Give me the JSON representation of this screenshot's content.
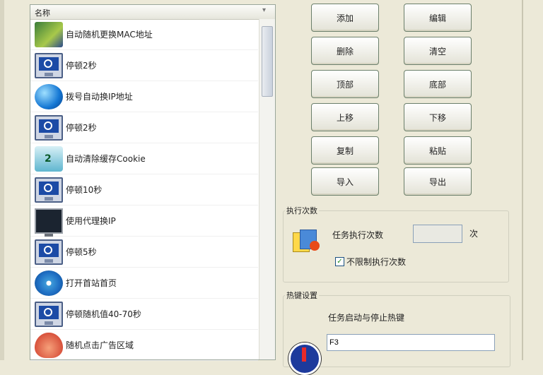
{
  "list": {
    "header": "名称",
    "items": [
      {
        "label": "自动随机更换MAC地址",
        "icon": "network-card-icon"
      },
      {
        "label": "停顿2秒",
        "icon": "monitor-clock-icon"
      },
      {
        "label": "拨号自动换IP地址",
        "icon": "globe-icon"
      },
      {
        "label": "停顿2秒",
        "icon": "monitor-clock-icon"
      },
      {
        "label": "自动清除缓存Cookie",
        "icon": "cookie-cleaner-icon"
      },
      {
        "label": "停顿10秒",
        "icon": "monitor-clock-icon"
      },
      {
        "label": "使用代理换IP",
        "icon": "screen-icon"
      },
      {
        "label": "停顿5秒",
        "icon": "monitor-clock-icon"
      },
      {
        "label": "打开首站首页",
        "icon": "disc-icon"
      },
      {
        "label": "停顿随机值40-70秒",
        "icon": "monitor-clock-icon"
      },
      {
        "label": "随机点击广告区域",
        "icon": "mouse-icon"
      }
    ]
  },
  "buttons": {
    "add": "添加",
    "edit": "编辑",
    "delete": "删除",
    "clear": "清空",
    "top": "顶部",
    "bottom": "底部",
    "move_up": "上移",
    "move_down": "下移",
    "copy": "复制",
    "paste": "粘贴",
    "import": "导入",
    "export": "导出"
  },
  "exec_group": {
    "title": "执行次数",
    "label": "任务执行次数",
    "value": "",
    "unit": "次",
    "unlimited_label": "不限制执行次数",
    "unlimited_checked": true
  },
  "hotkey_group": {
    "title": "热键设置",
    "label": "任务启动与停止热键",
    "value": "F3"
  }
}
